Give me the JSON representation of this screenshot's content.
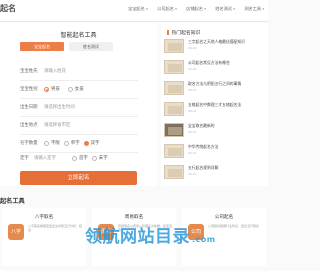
{
  "header": {
    "logo": "起名",
    "nav": [
      "宝宝起名",
      "公司起名",
      "店铺起名",
      "姓名测试",
      "测名工具"
    ]
  },
  "form": {
    "title": "智能起名工具",
    "tabs": [
      "宝宝起名",
      "姓名测试"
    ],
    "surname_label": "宝宝姓氏",
    "surname_placeholder": "请输入姓氏",
    "gender_label": "宝宝性别",
    "gender_male": "男孩",
    "gender_female": "女孩",
    "birthdate_label": "出生日期",
    "birthdate_placeholder": "请选择出生时间",
    "birthplace_label": "出生地点",
    "birthplace_placeholder": "请选择省市区",
    "namecount_label": "名字数量",
    "name_opt_none": "不限",
    "name_opt_single": "单字",
    "name_opt_double": "双字",
    "fixed_label": "定字",
    "fixed_placeholder": "请输入定字",
    "fixed_opt_first": "首字",
    "fixed_opt_last": "末字",
    "submit": "立即起名"
  },
  "side": {
    "title": "热门起名知识",
    "articles": [
      {
        "title": "三字起名之天地人格最佳搭配知识",
        "date": "06-01"
      },
      {
        "title": "公司起名常见方法有哪些",
        "date": "06-01"
      },
      {
        "title": "取名方法与阴阳五行之间的事情",
        "date": "06-01"
      },
      {
        "title": "五格起名中数理三才五格起名法",
        "date": "06-01"
      },
      {
        "title": "宝宝取名最新的",
        "date": "06-01"
      },
      {
        "title": "中华传统起名方法",
        "date": "06-01"
      },
      {
        "title": "五行起名规则详解",
        "date": "06-01"
      }
    ]
  },
  "tools": {
    "heading": "起名工具",
    "items": [
      {
        "name": "八字取名",
        "icon": "八字",
        "desc": "八字取名根据宝宝出生时辰五行分析，结合"
      },
      {
        "name": "周易取名",
        "icon": "周易",
        "desc": "周易取名以周易八卦理论为依据，给宝宝取个"
      },
      {
        "name": "公司起名",
        "icon": "公司",
        "desc": "公司起名根据行业特点，结合五行取名"
      }
    ]
  },
  "watermark": {
    "text": "领航网站目录",
    "suffix": ".com"
  },
  "colors": {
    "accent": "#ec7f48",
    "watermark": "#2396dc"
  }
}
